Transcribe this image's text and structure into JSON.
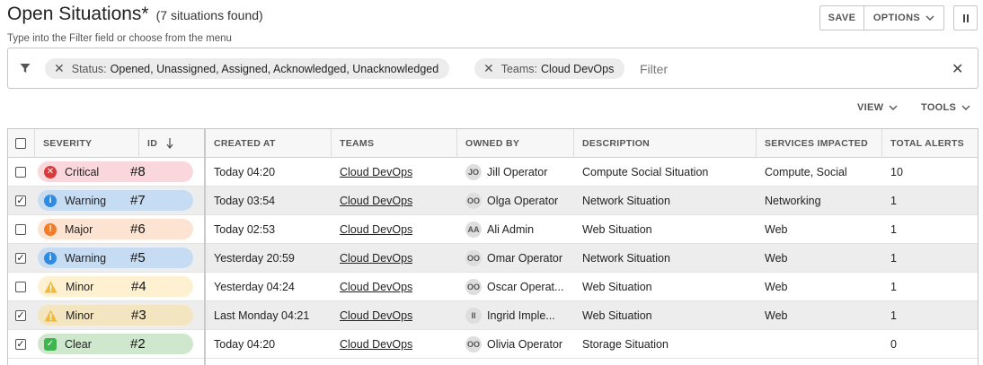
{
  "header": {
    "title": "Open Situations*",
    "count_text": "(7 situations found)",
    "hint": "Type into the Filter field or choose from the menu",
    "save_label": "SAVE",
    "options_label": "OPTIONS"
  },
  "filter": {
    "chips": [
      {
        "key": "Status:",
        "value": "Opened, Unassigned, Assigned, Acknowledged, Unacknowledged"
      },
      {
        "key": "Teams:",
        "value": "Cloud DevOps"
      }
    ],
    "placeholder": "Filter"
  },
  "toolbar": {
    "view_label": "VIEW",
    "tools_label": "TOOLS"
  },
  "columns": {
    "severity": "SEVERITY",
    "id": "ID",
    "created_at": "CREATED AT",
    "teams": "TEAMS",
    "owned_by": "OWNED BY",
    "description": "DESCRIPTION",
    "services": "SERVICES IMPACTED",
    "alerts": "TOTAL ALERTS"
  },
  "colors": {
    "critical": "#d93b3b",
    "warning": "#2f8be0",
    "major": "#ef7d2c",
    "minor": "#f0b93a",
    "clear": "#3fb54f"
  },
  "rows": [
    {
      "checked": false,
      "severity": "Critical",
      "icon": "x-circle-icon",
      "pill_bg": "#f9d7dc",
      "icon_color": "#d93b3b",
      "icon_shape": "circle",
      "icon_char": "✕",
      "id": "#8",
      "created": "Today 04:20",
      "team": "Cloud DevOps",
      "initials": "JO",
      "owner": "Jill Operator",
      "description": "Compute Social Situation",
      "services": "Compute, Social",
      "alerts": "10"
    },
    {
      "checked": true,
      "severity": "Warning",
      "icon": "info-circle-icon",
      "pill_bg": "#c6dcf2",
      "icon_color": "#2f8be0",
      "icon_shape": "circle",
      "icon_char": "i",
      "id": "#7",
      "created": "Today 03:54",
      "team": "Cloud DevOps",
      "initials": "OO",
      "owner": "Olga Operator",
      "description": "Network Situation",
      "services": "Networking",
      "alerts": "1"
    },
    {
      "checked": false,
      "severity": "Major",
      "icon": "exclamation-circle-icon",
      "pill_bg": "#fde3d2",
      "icon_color": "#ef7d2c",
      "icon_shape": "circle",
      "icon_char": "!",
      "id": "#6",
      "created": "Today 02:53",
      "team": "Cloud DevOps",
      "initials": "AA",
      "owner": "Ali Admin",
      "description": "Web Situation",
      "services": "Web",
      "alerts": "1"
    },
    {
      "checked": true,
      "severity": "Warning",
      "icon": "info-circle-icon",
      "pill_bg": "#c6dcf2",
      "icon_color": "#2f8be0",
      "icon_shape": "circle",
      "icon_char": "i",
      "id": "#5",
      "created": "Yesterday 20:59",
      "team": "Cloud DevOps",
      "initials": "OO",
      "owner": "Omar Operator",
      "description": "Network Situation",
      "services": "Web",
      "alerts": "1"
    },
    {
      "checked": false,
      "severity": "Minor",
      "icon": "warning-triangle-icon",
      "pill_bg": "#fdf1d1",
      "icon_color": "#f0b93a",
      "icon_shape": "triangle",
      "icon_char": "!",
      "id": "#4",
      "created": "Yesterday 04:24",
      "team": "Cloud DevOps",
      "initials": "OO",
      "owner": "Oscar Operat...",
      "description": "Web Situation",
      "services": "Web",
      "alerts": "1"
    },
    {
      "checked": true,
      "severity": "Minor",
      "icon": "warning-triangle-icon",
      "pill_bg": "#f3e5bf",
      "icon_color": "#f0b93a",
      "icon_shape": "triangle",
      "icon_char": "!",
      "id": "#3",
      "created": "Last Monday 04:21",
      "team": "Cloud DevOps",
      "initials": "II",
      "owner": "Ingrid Imple...",
      "description": "Web Situation",
      "services": "Web",
      "alerts": "1"
    },
    {
      "checked": true,
      "severity": "Clear",
      "icon": "check-square-icon",
      "pill_bg": "#cfe8cd",
      "icon_color": "#3fb54f",
      "icon_shape": "square",
      "icon_char": "✓",
      "id": "#2",
      "created": "Today 04:20",
      "team": "Cloud DevOps",
      "initials": "OO",
      "owner": "Olivia Operator",
      "description": "Storage Situation",
      "services": "",
      "alerts": "0"
    }
  ]
}
